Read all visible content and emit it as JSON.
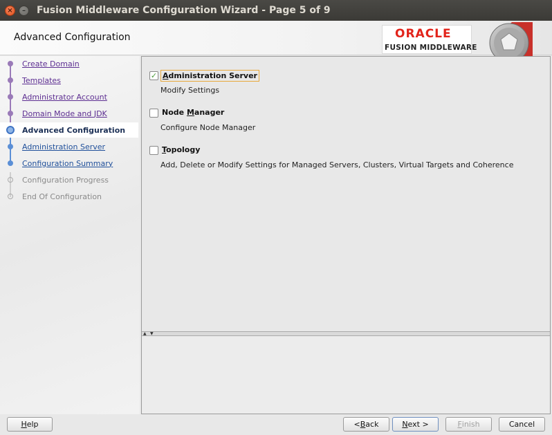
{
  "window": {
    "title": "Fusion Middleware Configuration Wizard - Page 5 of 9"
  },
  "header": {
    "page_title": "Advanced Configuration",
    "brand_top": "ORACLE",
    "brand_bottom": "FUSION MIDDLEWARE"
  },
  "nav": {
    "items": [
      {
        "label": "Create Domain",
        "state": "visited"
      },
      {
        "label": "Templates",
        "state": "visited"
      },
      {
        "label": "Administrator Account",
        "state": "visited"
      },
      {
        "label": "Domain Mode and JDK",
        "state": "visited"
      },
      {
        "label": "Advanced Configuration",
        "state": "current"
      },
      {
        "label": "Administration Server",
        "state": "upcoming"
      },
      {
        "label": "Configuration Summary",
        "state": "upcoming"
      },
      {
        "label": "Configuration Progress",
        "state": "disabled"
      },
      {
        "label": "End Of Configuration",
        "state": "disabled"
      }
    ]
  },
  "options": [
    {
      "label": "Administration Server",
      "mnemonic_index": 0,
      "description": "Modify Settings",
      "checked": true
    },
    {
      "label": "Node Manager",
      "mnemonic_index": 5,
      "description": "Configure Node Manager",
      "checked": false
    },
    {
      "label": "Topology",
      "mnemonic_index": 0,
      "description": "Add, Delete or Modify Settings for Managed Servers, Clusters, Virtual Targets and Coherence",
      "checked": false
    }
  ],
  "buttons": {
    "help": "Help",
    "back": "< Back",
    "next": "Next >",
    "finish": "Finish",
    "cancel": "Cancel"
  },
  "colors": {
    "oracle_red": "#e2231a",
    "visited_link": "#5c2d91",
    "upcoming_link": "#1f4f9a",
    "check_green": "#4a9a3a",
    "focus_border": "#e8a83a"
  }
}
